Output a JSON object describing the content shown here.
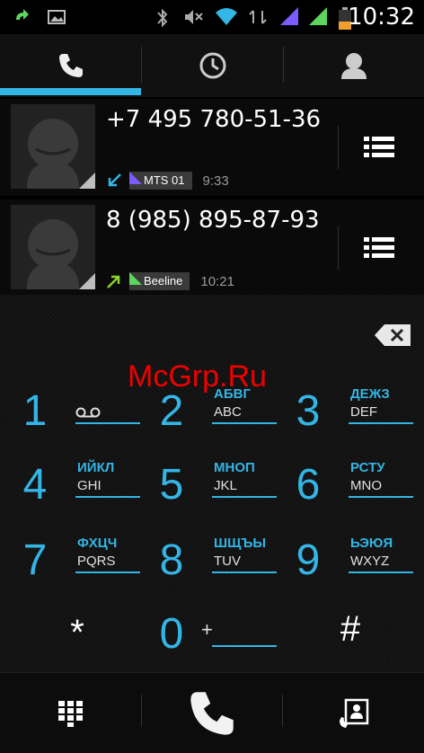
{
  "status_bar": {
    "time": "10:32",
    "icons": [
      "call-forward-icon",
      "image-icon",
      "bluetooth-icon",
      "mute-icon",
      "wifi-icon",
      "data-sync-icon",
      "signal-sim1-icon",
      "signal-sim2-icon",
      "battery-icon"
    ]
  },
  "tabs": [
    {
      "icon": "phone-icon",
      "active": true
    },
    {
      "icon": "clock-icon",
      "active": false
    },
    {
      "icon": "contacts-icon",
      "active": false
    }
  ],
  "call_log": [
    {
      "number": "+7 495 780-51-36",
      "direction": "incoming-call-icon",
      "sim": "MTS 01",
      "sim_color": "#7b5cff",
      "time": "9:33"
    },
    {
      "number": "8 (985) 895-87-93",
      "direction": "outgoing-call-icon",
      "sim": "Beeline",
      "sim_color": "#5cd65c",
      "time": "10:21"
    }
  ],
  "keypad": {
    "k1": {
      "digit": "1",
      "cyr": "",
      "lat": "",
      "icon": "voicemail-icon"
    },
    "k2": {
      "digit": "2",
      "cyr": "АБВГ",
      "lat": "ABC"
    },
    "k3": {
      "digit": "3",
      "cyr": "ДЕЖЗ",
      "lat": "DEF"
    },
    "k4": {
      "digit": "4",
      "cyr": "ИЙКЛ",
      "lat": "GHI"
    },
    "k5": {
      "digit": "5",
      "cyr": "МНОП",
      "lat": "JKL"
    },
    "k6": {
      "digit": "6",
      "cyr": "РСТУ",
      "lat": "MNO"
    },
    "k7": {
      "digit": "7",
      "cyr": "ФХЦЧ",
      "lat": "PQRS"
    },
    "k8": {
      "digit": "8",
      "cyr": "ШЩЪЫ",
      "lat": "TUV"
    },
    "k9": {
      "digit": "9",
      "cyr": "ЬЭЮЯ",
      "lat": "WXYZ"
    },
    "k0": {
      "digit": "0",
      "lat": "+"
    },
    "star": "*",
    "hash": "#"
  },
  "watermark": "McGrp.Ru",
  "accent_color": "#33b5e5"
}
